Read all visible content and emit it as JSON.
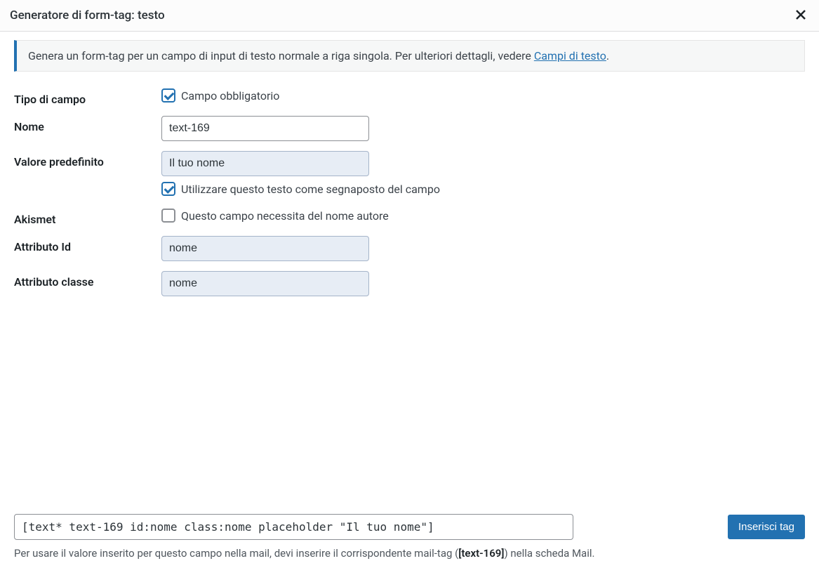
{
  "header": {
    "title": "Generatore di form-tag: testo"
  },
  "banner": {
    "text_before_link": "Genera un form-tag per un campo di input di testo normale a riga singola. Per ulteriori dettagli, vedere ",
    "link_text": "Campi di testo",
    "text_after_link": "."
  },
  "fields": {
    "field_type": {
      "label": "Tipo di campo",
      "checkbox_label": "Campo obbligatorio"
    },
    "name": {
      "label": "Nome",
      "value": "text-169"
    },
    "default_value": {
      "label": "Valore predefinito",
      "value": "Il tuo nome",
      "placeholder_checkbox_label": "Utilizzare questo testo come segnaposto del campo"
    },
    "akismet": {
      "label": "Akismet",
      "checkbox_label": "Questo campo necessita del nome autore"
    },
    "id_attr": {
      "label": "Attributo Id",
      "value": "nome"
    },
    "class_attr": {
      "label": "Attributo classe",
      "value": "nome"
    }
  },
  "footer": {
    "tag_output": "[text* text-169 id:nome class:nome placeholder \"Il tuo nome\"]",
    "insert_button": "Inserisci tag",
    "hint_before": "Per usare il valore inserito per questo campo nella mail, devi inserire il corrispondente mail-tag (",
    "hint_strong": "[text-169]",
    "hint_after": ") nella scheda Mail."
  }
}
